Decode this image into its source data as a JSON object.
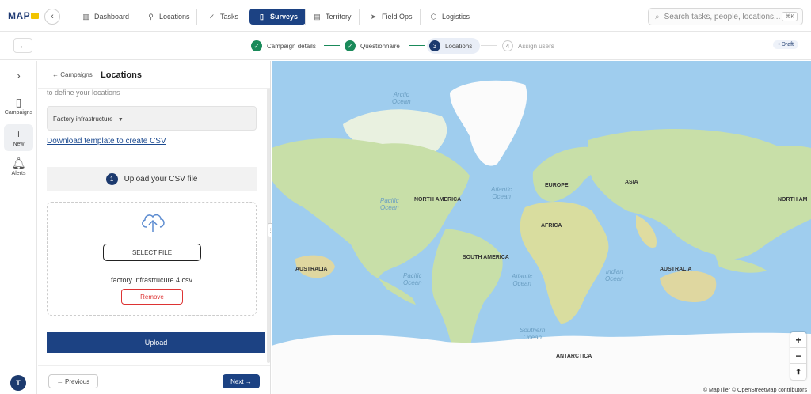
{
  "app": {
    "logo_text": "MAP"
  },
  "nav": {
    "items": [
      {
        "label": "Dashboard",
        "icon": "bar-chart-icon"
      },
      {
        "label": "Locations",
        "icon": "pin-icon"
      },
      {
        "label": "Tasks",
        "icon": "check-icon"
      },
      {
        "label": "Surveys",
        "icon": "clipboard-icon"
      },
      {
        "label": "Territory",
        "icon": "map-icon"
      },
      {
        "label": "Field Ops",
        "icon": "send-icon"
      },
      {
        "label": "Logistics",
        "icon": "box-icon"
      }
    ],
    "active": "Surveys"
  },
  "search": {
    "placeholder": "Search tasks, people, locations...",
    "shortcut": "⌘K"
  },
  "steps": [
    {
      "label": "Campaign details",
      "state": "done"
    },
    {
      "label": "Questionnaire",
      "state": "done"
    },
    {
      "number": "3",
      "label": "Locations",
      "state": "current"
    },
    {
      "number": "4",
      "label": "Assign users",
      "state": "pending"
    }
  ],
  "status_badge": "• Draft",
  "rail": {
    "items": [
      {
        "label": "Campaigns",
        "icon": "clipboard-icon"
      },
      {
        "label": "New",
        "icon": "plus-icon"
      },
      {
        "label": "Alerts",
        "icon": "bell-icon"
      }
    ],
    "avatar": "T"
  },
  "panel": {
    "breadcrumb": "← Campaigns",
    "title": "Locations",
    "helper": "to define your locations",
    "select_value": "Factory infrastructure",
    "download_link": "Download template to create CSV",
    "upload_step_number": "1",
    "upload_heading": "Upload your CSV file",
    "select_file_label": "SELECT FILE",
    "file_name": "factory infrastrucure 4.csv",
    "remove_label": "Remove",
    "upload_label": "Upload",
    "previous_label": "← Previous",
    "next_label": "Next →"
  },
  "map": {
    "continents": [
      "NORTH AMERICA",
      "SOUTH AMERICA",
      "EUROPE",
      "AFRICA",
      "ASIA",
      "AUSTRALIA",
      "AUSTRALIA",
      "ANTARCTICA",
      "NORTH AM"
    ],
    "oceans": [
      "Arctic\nOcean",
      "Pacific\nOcean",
      "Atlantic\nOcean",
      "Pacific\nOcean",
      "Atlantic\nOcean",
      "Indian\nOcean",
      "Southern\nOcean"
    ],
    "zoom_in": "+",
    "zoom_out": "−",
    "compass": "⬆",
    "attribution": "© MapTiler © OpenStreetMap contributors"
  },
  "colors": {
    "primary": "#1c4283",
    "success": "#1a8a5a",
    "danger": "#d33333",
    "ocean": "#9fcdee",
    "land": "#c8dfa8"
  }
}
